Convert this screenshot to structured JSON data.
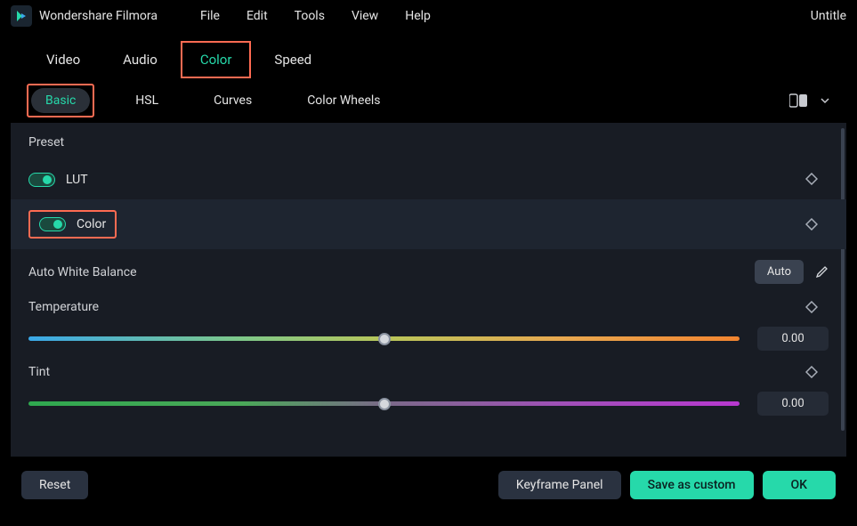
{
  "app": {
    "name": "Wondershare Filmora",
    "docTitle": "Untitle"
  },
  "menu": [
    "File",
    "Edit",
    "Tools",
    "View",
    "Help"
  ],
  "topTabs": [
    {
      "label": "Video",
      "active": false,
      "highlight": false
    },
    {
      "label": "Audio",
      "active": false,
      "highlight": false
    },
    {
      "label": "Color",
      "active": true,
      "highlight": true
    },
    {
      "label": "Speed",
      "active": false,
      "highlight": false
    }
  ],
  "subTabs": [
    {
      "label": "Basic",
      "active": true,
      "highlight": true
    },
    {
      "label": "HSL",
      "active": false,
      "highlight": false
    },
    {
      "label": "Curves",
      "active": false,
      "highlight": false
    },
    {
      "label": "Color Wheels",
      "active": false,
      "highlight": false
    }
  ],
  "presetLabel": "Preset",
  "lut": {
    "label": "LUT",
    "on": true
  },
  "color": {
    "label": "Color",
    "on": true,
    "highlight": true
  },
  "autoWB": {
    "label": "Auto White Balance",
    "button": "Auto"
  },
  "temperature": {
    "label": "Temperature",
    "value": "0.00"
  },
  "tint": {
    "label": "Tint",
    "value": "0.00"
  },
  "footer": {
    "reset": "Reset",
    "keyframe": "Keyframe Panel",
    "save": "Save as custom",
    "ok": "OK"
  },
  "icons": {
    "compare": "compare-icon",
    "chevronDown": "chevron-down-icon",
    "diamond": "diamond-icon",
    "eyedropper": "eyedropper-icon",
    "logo": "filmora-logo"
  },
  "colors": {
    "accent": "#26d9aa",
    "highlight": "#ff6b52",
    "panelBg": "#181c24"
  }
}
